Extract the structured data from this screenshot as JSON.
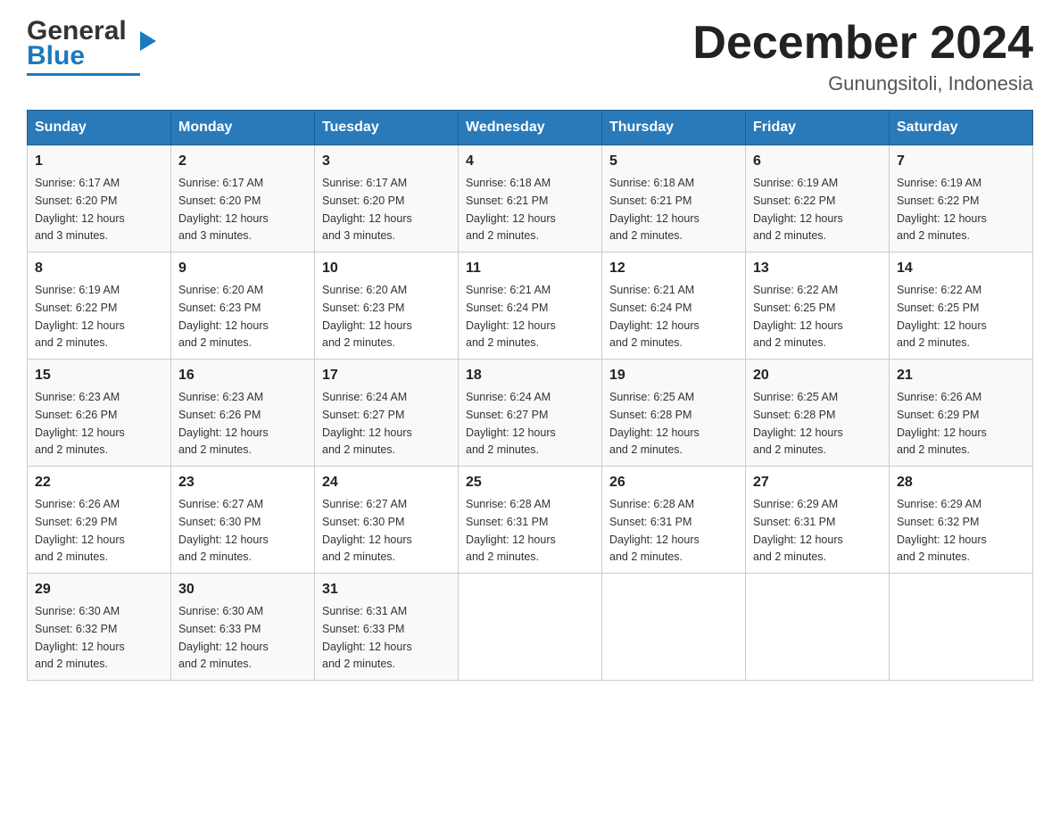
{
  "header": {
    "logo_general": "General",
    "logo_blue": "Blue",
    "month_title": "December 2024",
    "location": "Gunungsitoli, Indonesia"
  },
  "days_of_week": [
    "Sunday",
    "Monday",
    "Tuesday",
    "Wednesday",
    "Thursday",
    "Friday",
    "Saturday"
  ],
  "weeks": [
    [
      {
        "day": "1",
        "sunrise": "6:17 AM",
        "sunset": "6:20 PM",
        "daylight": "12 hours and 3 minutes."
      },
      {
        "day": "2",
        "sunrise": "6:17 AM",
        "sunset": "6:20 PM",
        "daylight": "12 hours and 3 minutes."
      },
      {
        "day": "3",
        "sunrise": "6:17 AM",
        "sunset": "6:20 PM",
        "daylight": "12 hours and 3 minutes."
      },
      {
        "day": "4",
        "sunrise": "6:18 AM",
        "sunset": "6:21 PM",
        "daylight": "12 hours and 2 minutes."
      },
      {
        "day": "5",
        "sunrise": "6:18 AM",
        "sunset": "6:21 PM",
        "daylight": "12 hours and 2 minutes."
      },
      {
        "day": "6",
        "sunrise": "6:19 AM",
        "sunset": "6:22 PM",
        "daylight": "12 hours and 2 minutes."
      },
      {
        "day": "7",
        "sunrise": "6:19 AM",
        "sunset": "6:22 PM",
        "daylight": "12 hours and 2 minutes."
      }
    ],
    [
      {
        "day": "8",
        "sunrise": "6:19 AM",
        "sunset": "6:22 PM",
        "daylight": "12 hours and 2 minutes."
      },
      {
        "day": "9",
        "sunrise": "6:20 AM",
        "sunset": "6:23 PM",
        "daylight": "12 hours and 2 minutes."
      },
      {
        "day": "10",
        "sunrise": "6:20 AM",
        "sunset": "6:23 PM",
        "daylight": "12 hours and 2 minutes."
      },
      {
        "day": "11",
        "sunrise": "6:21 AM",
        "sunset": "6:24 PM",
        "daylight": "12 hours and 2 minutes."
      },
      {
        "day": "12",
        "sunrise": "6:21 AM",
        "sunset": "6:24 PM",
        "daylight": "12 hours and 2 minutes."
      },
      {
        "day": "13",
        "sunrise": "6:22 AM",
        "sunset": "6:25 PM",
        "daylight": "12 hours and 2 minutes."
      },
      {
        "day": "14",
        "sunrise": "6:22 AM",
        "sunset": "6:25 PM",
        "daylight": "12 hours and 2 minutes."
      }
    ],
    [
      {
        "day": "15",
        "sunrise": "6:23 AM",
        "sunset": "6:26 PM",
        "daylight": "12 hours and 2 minutes."
      },
      {
        "day": "16",
        "sunrise": "6:23 AM",
        "sunset": "6:26 PM",
        "daylight": "12 hours and 2 minutes."
      },
      {
        "day": "17",
        "sunrise": "6:24 AM",
        "sunset": "6:27 PM",
        "daylight": "12 hours and 2 minutes."
      },
      {
        "day": "18",
        "sunrise": "6:24 AM",
        "sunset": "6:27 PM",
        "daylight": "12 hours and 2 minutes."
      },
      {
        "day": "19",
        "sunrise": "6:25 AM",
        "sunset": "6:28 PM",
        "daylight": "12 hours and 2 minutes."
      },
      {
        "day": "20",
        "sunrise": "6:25 AM",
        "sunset": "6:28 PM",
        "daylight": "12 hours and 2 minutes."
      },
      {
        "day": "21",
        "sunrise": "6:26 AM",
        "sunset": "6:29 PM",
        "daylight": "12 hours and 2 minutes."
      }
    ],
    [
      {
        "day": "22",
        "sunrise": "6:26 AM",
        "sunset": "6:29 PM",
        "daylight": "12 hours and 2 minutes."
      },
      {
        "day": "23",
        "sunrise": "6:27 AM",
        "sunset": "6:30 PM",
        "daylight": "12 hours and 2 minutes."
      },
      {
        "day": "24",
        "sunrise": "6:27 AM",
        "sunset": "6:30 PM",
        "daylight": "12 hours and 2 minutes."
      },
      {
        "day": "25",
        "sunrise": "6:28 AM",
        "sunset": "6:31 PM",
        "daylight": "12 hours and 2 minutes."
      },
      {
        "day": "26",
        "sunrise": "6:28 AM",
        "sunset": "6:31 PM",
        "daylight": "12 hours and 2 minutes."
      },
      {
        "day": "27",
        "sunrise": "6:29 AM",
        "sunset": "6:31 PM",
        "daylight": "12 hours and 2 minutes."
      },
      {
        "day": "28",
        "sunrise": "6:29 AM",
        "sunset": "6:32 PM",
        "daylight": "12 hours and 2 minutes."
      }
    ],
    [
      {
        "day": "29",
        "sunrise": "6:30 AM",
        "sunset": "6:32 PM",
        "daylight": "12 hours and 2 minutes."
      },
      {
        "day": "30",
        "sunrise": "6:30 AM",
        "sunset": "6:33 PM",
        "daylight": "12 hours and 2 minutes."
      },
      {
        "day": "31",
        "sunrise": "6:31 AM",
        "sunset": "6:33 PM",
        "daylight": "12 hours and 2 minutes."
      },
      null,
      null,
      null,
      null
    ]
  ],
  "labels": {
    "sunrise": "Sunrise:",
    "sunset": "Sunset:",
    "daylight": "Daylight: 12 hours"
  }
}
